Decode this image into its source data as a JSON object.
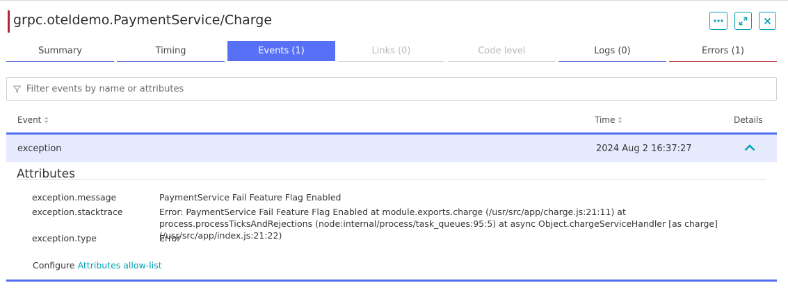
{
  "header": {
    "title": "grpc.oteldemo.PaymentService/Charge",
    "accent_color": "#b4232f",
    "buttons": [
      {
        "name": "more-options",
        "icon": "ellipsis-icon"
      },
      {
        "name": "expand",
        "icon": "expand-arrows-icon"
      },
      {
        "name": "close",
        "icon": "close-icon"
      }
    ]
  },
  "tabs": [
    {
      "label": "Summary",
      "state": "normal"
    },
    {
      "label": "Timing",
      "state": "normal"
    },
    {
      "label": "Events (1)",
      "state": "active"
    },
    {
      "label": "Links (0)",
      "state": "disabled"
    },
    {
      "label": "Code level",
      "state": "disabled"
    },
    {
      "label": "Logs (0)",
      "state": "normal"
    },
    {
      "label": "Errors (1)",
      "state": "error"
    }
  ],
  "filter": {
    "placeholder": "Filter events by name or attributes",
    "value": "",
    "icon": "filter-icon"
  },
  "table": {
    "columns": {
      "event": "Event",
      "time": "Time",
      "details": "Details"
    },
    "rows": [
      {
        "event": "exception",
        "time": "2024 Aug 2 16:37:27",
        "expanded": true
      }
    ]
  },
  "attributes": {
    "title": "Attributes",
    "items": [
      {
        "key": "exception.message",
        "value": "PaymentService Fail Feature Flag Enabled"
      },
      {
        "key": "exception.stacktrace",
        "value": "Error: PaymentService Fail Feature Flag Enabled at module.exports.charge (/usr/src/app/charge.js:21:11) at process.processTicksAndRejections (node:internal/process/task_queues:95:5) at async Object.chargeServiceHandler [as charge] (/usr/src/app/index.js:21:22)"
      },
      {
        "key": "exception.type",
        "value": "Error"
      }
    ],
    "configure_prefix": "Configure",
    "configure_link": "Attributes allow-list"
  },
  "colors": {
    "primary": "#5870f6",
    "teal": "#00a1b2",
    "error": "#b4232f",
    "row_highlight": "#e6eafd"
  }
}
